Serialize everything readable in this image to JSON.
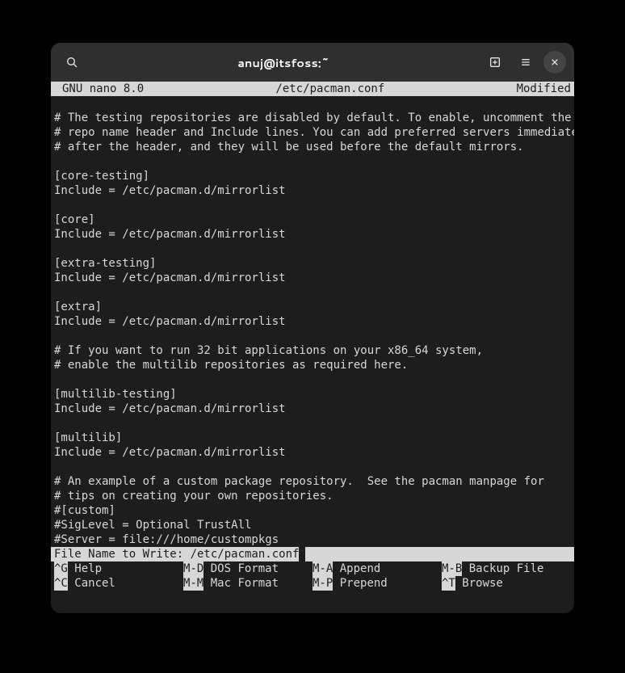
{
  "window": {
    "title": "anuj@itsfoss:~"
  },
  "nano": {
    "app": "GNU nano 8.0",
    "filename": "/etc/pacman.conf",
    "status": "Modified"
  },
  "content_lines": [
    "",
    "# The testing repositories are disabled by default. To enable, uncomment the",
    "# repo name header and Include lines. You can add preferred servers immediately",
    "# after the header, and they will be used before the default mirrors.",
    "",
    "[core-testing]",
    "Include = /etc/pacman.d/mirrorlist",
    "",
    "[core]",
    "Include = /etc/pacman.d/mirrorlist",
    "",
    "[extra-testing]",
    "Include = /etc/pacman.d/mirrorlist",
    "",
    "[extra]",
    "Include = /etc/pacman.d/mirrorlist",
    "",
    "# If you want to run 32 bit applications on your x86_64 system,",
    "# enable the multilib repositories as required here.",
    "",
    "[multilib-testing]",
    "Include = /etc/pacman.d/mirrorlist",
    "",
    "[multilib]",
    "Include = /etc/pacman.d/mirrorlist",
    "",
    "# An example of a custom package repository.  See the pacman manpage for",
    "# tips on creating your own repositories.",
    "#[custom]",
    "#SigLevel = Optional TrustAll",
    "#Server = file:///home/custompkgs",
    ""
  ],
  "writeline": {
    "label": "File Name to Write: ",
    "value": "/etc/pacman.conf"
  },
  "shortcuts": [
    [
      {
        "key": "^G",
        "label": "Help"
      },
      {
        "key": "M-D",
        "label": "DOS Format"
      },
      {
        "key": "M-A",
        "label": "Append"
      },
      {
        "key": "M-B",
        "label": "Backup File"
      }
    ],
    [
      {
        "key": "^C",
        "label": "Cancel"
      },
      {
        "key": "M-M",
        "label": "Mac Format"
      },
      {
        "key": "M-P",
        "label": "Prepend"
      },
      {
        "key": "^T",
        "label": "Browse"
      }
    ]
  ],
  "icons": {
    "search": "search-icon",
    "new_tab": "new-tab-icon",
    "menu": "menu-icon",
    "close": "close-icon"
  }
}
